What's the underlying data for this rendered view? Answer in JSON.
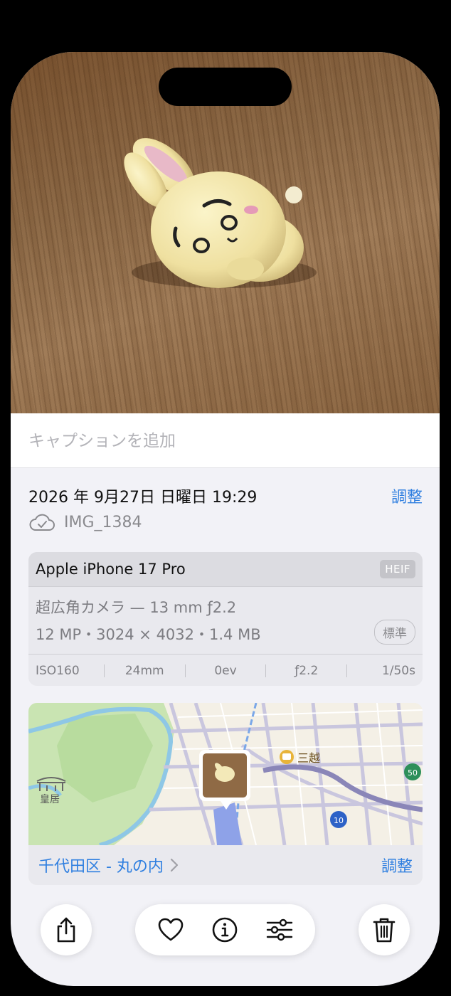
{
  "caption": {
    "placeholder": "キャプションを追加"
  },
  "info": {
    "datetime": "2026 年 9月27日 日曜日 19:29",
    "adjust_label": "調整",
    "filename": "IMG_1384"
  },
  "camera": {
    "device": "Apple iPhone 17 Pro",
    "format": "HEIF",
    "lens": "超広角カメラ — 13 mm ƒ2.2",
    "specs": "12 MP・3024 × 4032・1.4 MB",
    "quality_badge": "標準",
    "exif": [
      "ISO160",
      "24mm",
      "0ev",
      "ƒ2.2",
      "1/50s"
    ]
  },
  "map": {
    "landmark_palace": "皇居",
    "landmark_store": "三越",
    "route_50": "50",
    "route_10": "10",
    "place": "千代田区 - 丸の内",
    "adjust_label": "調整"
  },
  "colors": {
    "accent": "#2f7fe0",
    "background": "#f2f2f7"
  },
  "toolbar": {
    "icons": [
      "share-icon",
      "heart-icon",
      "info-icon",
      "sliders-icon",
      "trash-icon"
    ]
  }
}
